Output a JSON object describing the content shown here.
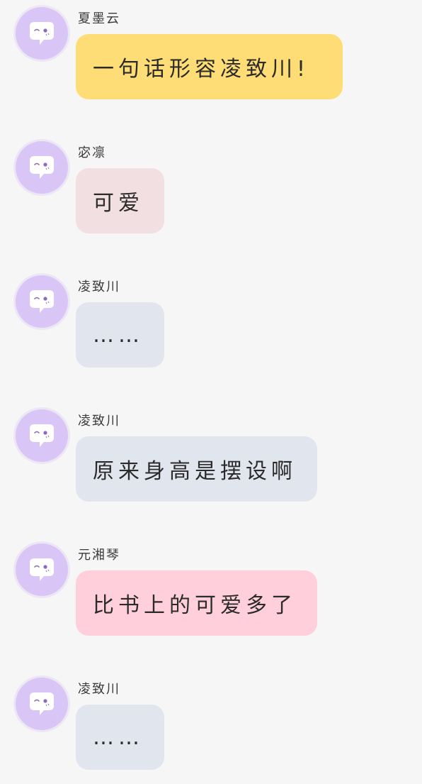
{
  "messages": [
    {
      "sender": "夏墨云",
      "text": "一句话形容凌致川!",
      "bubble_color": "#ffdd76"
    },
    {
      "sender": "宓凛",
      "text": "可爱",
      "bubble_color": "#f2dfe1"
    },
    {
      "sender": "凌致川",
      "text": "……",
      "bubble_color": "#e1e6ee"
    },
    {
      "sender": "凌致川",
      "text": "原来身高是摆设啊",
      "bubble_color": "#e1e6ee"
    },
    {
      "sender": "元湘琴",
      "text": "比书上的可爱多了",
      "bubble_color": "#ffd0dc"
    },
    {
      "sender": "凌致川",
      "text": "……",
      "bubble_color": "#e1e6ee"
    }
  ],
  "avatar": {
    "icon": "chat-bubble-face-icon",
    "color": "#d9c6f7"
  }
}
